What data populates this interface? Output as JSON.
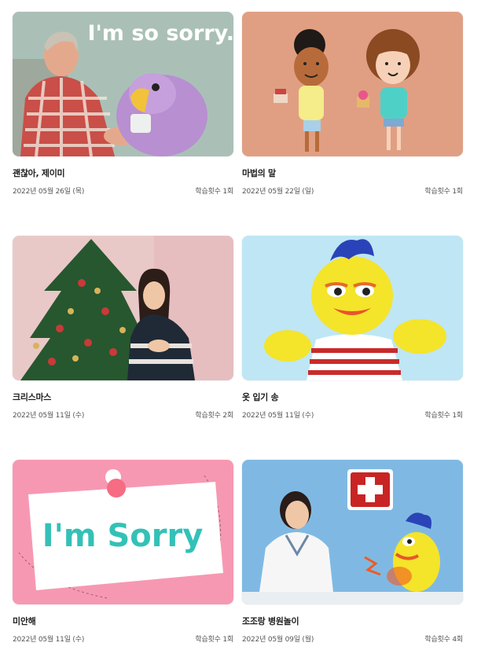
{
  "videos": [
    {
      "title": "괜찮아, 제이미",
      "date": "2022년 05월 26일 (목)",
      "count": "학습횟수 1회",
      "overlay_text": "I'm so sorry."
    },
    {
      "title": "마법의 말",
      "date": "2022년 05월 22일 (일)",
      "count": "학습횟수 1회"
    },
    {
      "title": "크리스마스",
      "date": "2022년 05월 11일 (수)",
      "count": "학습횟수 2회"
    },
    {
      "title": "옷 입기 송",
      "date": "2022년 05월 11일 (수)",
      "count": "학습횟수 1회"
    },
    {
      "title": "미안해",
      "date": "2022년 05월 11일 (수)",
      "count": "학습횟수 1회",
      "overlay_text": "I'm Sorry"
    },
    {
      "title": "조조랑 병원놀이",
      "date": "2022년 05월 09일 (월)",
      "count": "학습횟수 4회"
    }
  ],
  "colors": {
    "thumb_1_bg": "#9fb9b1",
    "thumb_2_bg": "#e09f83",
    "thumb_3_bg": "#e8c9c7",
    "thumb_4_bg": "#bfe6f4",
    "thumb_5_bg": "#f798b3",
    "thumb_6_bg": "#7fb9e3"
  }
}
